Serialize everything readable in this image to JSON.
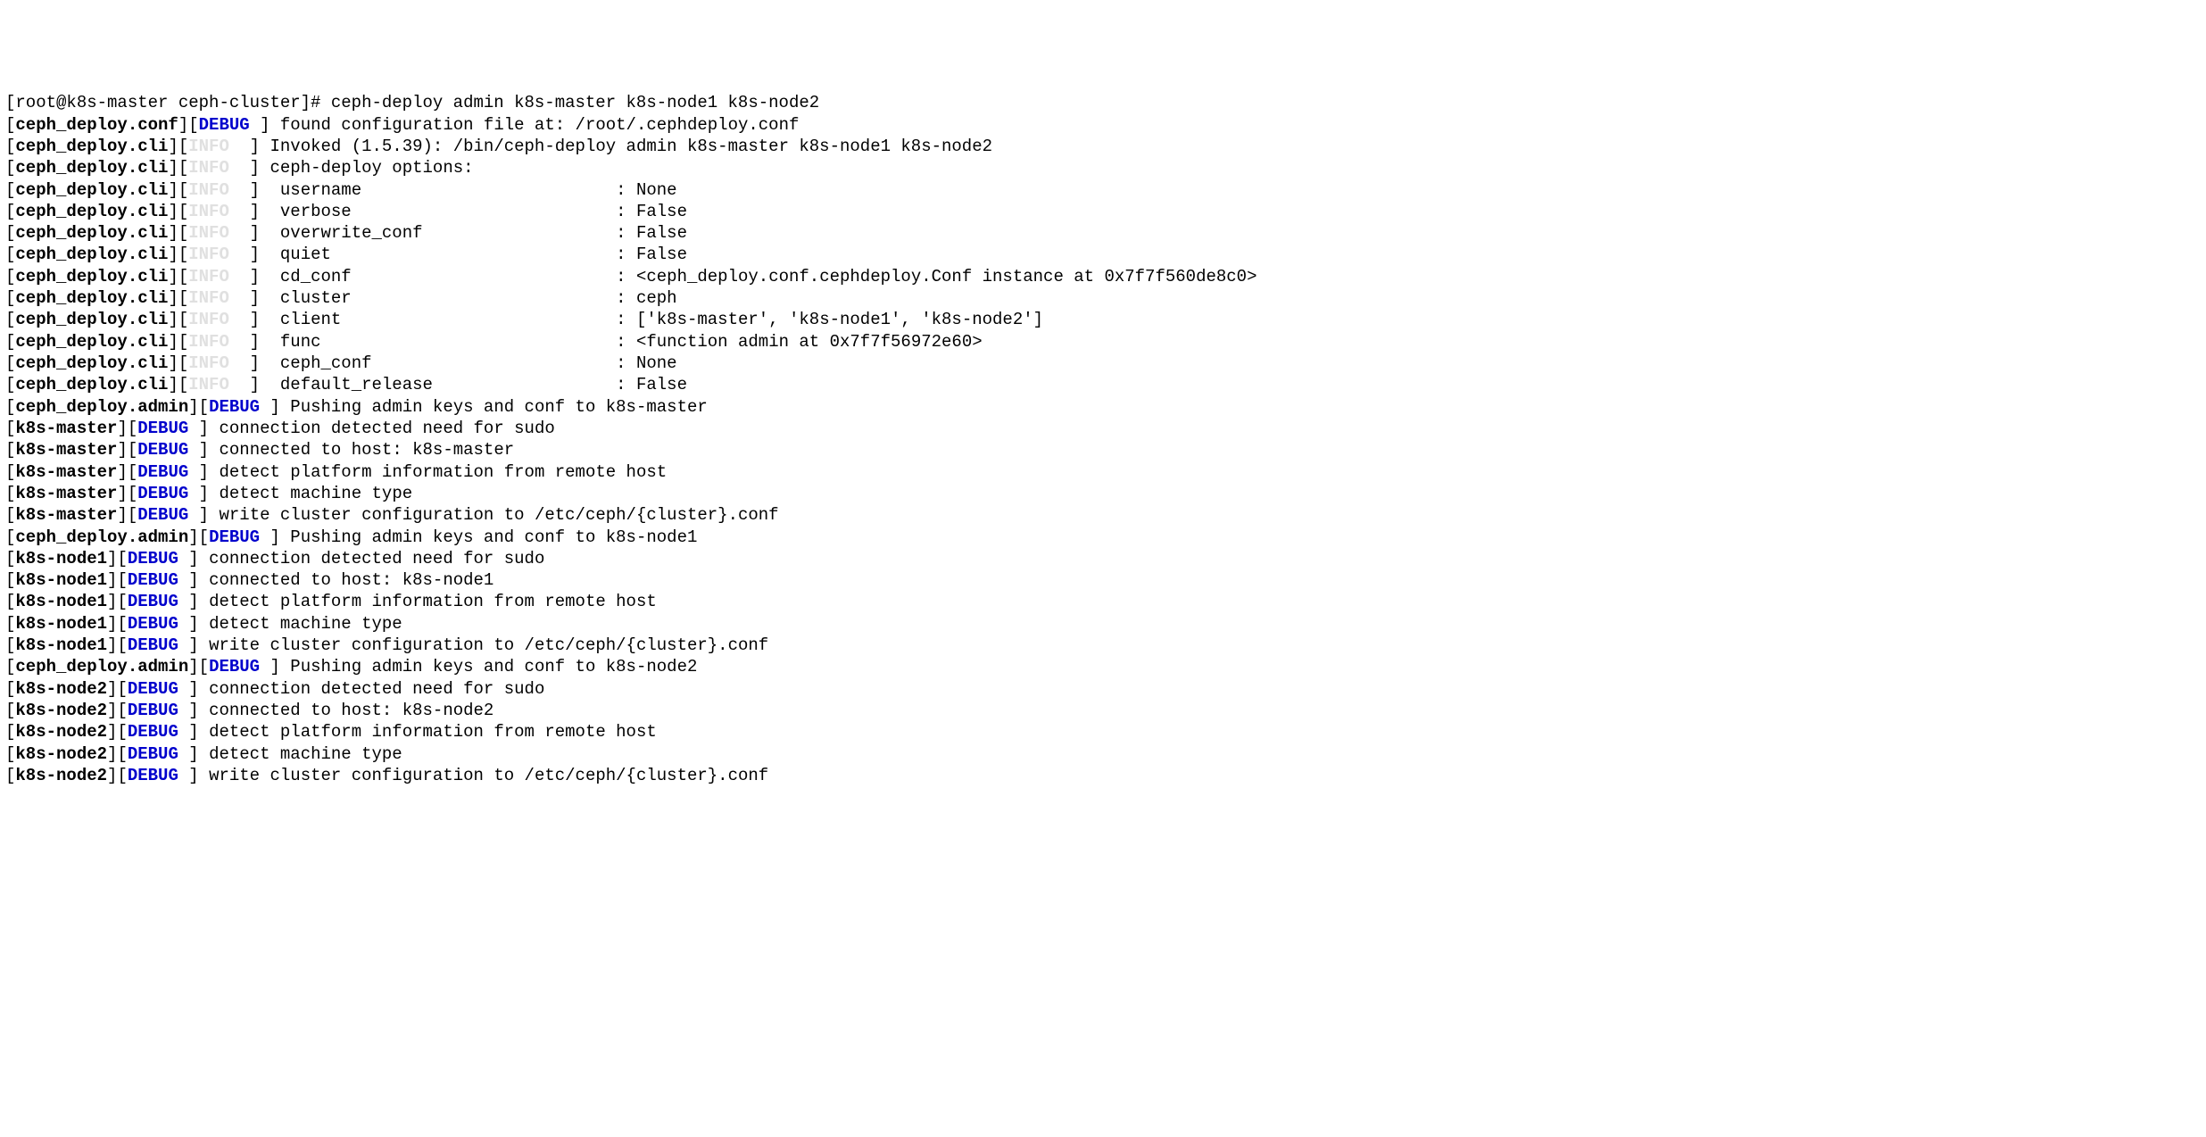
{
  "prompt": {
    "prefix": "[root@k8s-master ceph-cluster]# ",
    "command": "ceph-deploy admin k8s-master k8s-node1 k8s-node2"
  },
  "lines": [
    {
      "module": "ceph_deploy.conf",
      "level": "DEBUG",
      "fade": false,
      "msg": "found configuration file at: /root/.cephdeploy.conf"
    },
    {
      "module": "ceph_deploy.cli",
      "level": "INFO",
      "fade": true,
      "msg": "Invoked (1.5.39): /bin/ceph-deploy admin k8s-master k8s-node1 k8s-node2"
    },
    {
      "module": "ceph_deploy.cli",
      "level": "INFO",
      "fade": true,
      "msg": "ceph-deploy options:"
    },
    {
      "module": "ceph_deploy.cli",
      "level": "INFO",
      "fade": true,
      "opt": "username",
      "val": "None"
    },
    {
      "module": "ceph_deploy.cli",
      "level": "INFO",
      "fade": true,
      "opt": "verbose",
      "val": "False"
    },
    {
      "module": "ceph_deploy.cli",
      "level": "INFO",
      "fade": true,
      "opt": "overwrite_conf",
      "val": "False"
    },
    {
      "module": "ceph_deploy.cli",
      "level": "INFO",
      "fade": true,
      "opt": "quiet",
      "val": "False"
    },
    {
      "module": "ceph_deploy.cli",
      "level": "INFO",
      "fade": true,
      "opt": "cd_conf",
      "val": "<ceph_deploy.conf.cephdeploy.Conf instance at 0x7f7f560de8c0>"
    },
    {
      "module": "ceph_deploy.cli",
      "level": "INFO",
      "fade": true,
      "opt": "cluster",
      "val": "ceph"
    },
    {
      "module": "ceph_deploy.cli",
      "level": "INFO",
      "fade": true,
      "opt": "client",
      "val": "['k8s-master', 'k8s-node1', 'k8s-node2']"
    },
    {
      "module": "ceph_deploy.cli",
      "level": "INFO",
      "fade": true,
      "opt": "func",
      "val": "<function admin at 0x7f7f56972e60>"
    },
    {
      "module": "ceph_deploy.cli",
      "level": "INFO",
      "fade": true,
      "opt": "ceph_conf",
      "val": "None"
    },
    {
      "module": "ceph_deploy.cli",
      "level": "INFO",
      "fade": true,
      "opt": "default_release",
      "val": "False"
    },
    {
      "module": "ceph_deploy.admin",
      "level": "DEBUG",
      "fade": false,
      "msg": "Pushing admin keys and conf to k8s-master"
    },
    {
      "module": "k8s-master",
      "level": "DEBUG",
      "fade": false,
      "msg": "connection detected need for sudo"
    },
    {
      "module": "k8s-master",
      "level": "DEBUG",
      "fade": false,
      "msg": "connected to host: k8s-master"
    },
    {
      "module": "k8s-master",
      "level": "DEBUG",
      "fade": false,
      "msg": "detect platform information from remote host"
    },
    {
      "module": "k8s-master",
      "level": "DEBUG",
      "fade": false,
      "msg": "detect machine type"
    },
    {
      "module": "k8s-master",
      "level": "DEBUG",
      "fade": false,
      "msg": "write cluster configuration to /etc/ceph/{cluster}.conf"
    },
    {
      "module": "ceph_deploy.admin",
      "level": "DEBUG",
      "fade": false,
      "msg": "Pushing admin keys and conf to k8s-node1"
    },
    {
      "module": "k8s-node1",
      "level": "DEBUG",
      "fade": false,
      "msg": "connection detected need for sudo"
    },
    {
      "module": "k8s-node1",
      "level": "DEBUG",
      "fade": false,
      "msg": "connected to host: k8s-node1"
    },
    {
      "module": "k8s-node1",
      "level": "DEBUG",
      "fade": false,
      "msg": "detect platform information from remote host"
    },
    {
      "module": "k8s-node1",
      "level": "DEBUG",
      "fade": false,
      "msg": "detect machine type"
    },
    {
      "module": "k8s-node1",
      "level": "DEBUG",
      "fade": false,
      "msg": "write cluster configuration to /etc/ceph/{cluster}.conf"
    },
    {
      "module": "ceph_deploy.admin",
      "level": "DEBUG",
      "fade": false,
      "msg": "Pushing admin keys and conf to k8s-node2"
    },
    {
      "module": "k8s-node2",
      "level": "DEBUG",
      "fade": false,
      "msg": "connection detected need for sudo"
    },
    {
      "module": "k8s-node2",
      "level": "DEBUG",
      "fade": false,
      "msg": "connected to host: k8s-node2"
    },
    {
      "module": "k8s-node2",
      "level": "DEBUG",
      "fade": false,
      "msg": "detect platform information from remote host"
    },
    {
      "module": "k8s-node2",
      "level": "DEBUG",
      "fade": false,
      "msg": "detect machine type"
    },
    {
      "module": "k8s-node2",
      "level": "DEBUG",
      "fade": false,
      "msg": "write cluster configuration to /etc/ceph/{cluster}.conf"
    }
  ],
  "option_pad": 33,
  "watermark": ""
}
